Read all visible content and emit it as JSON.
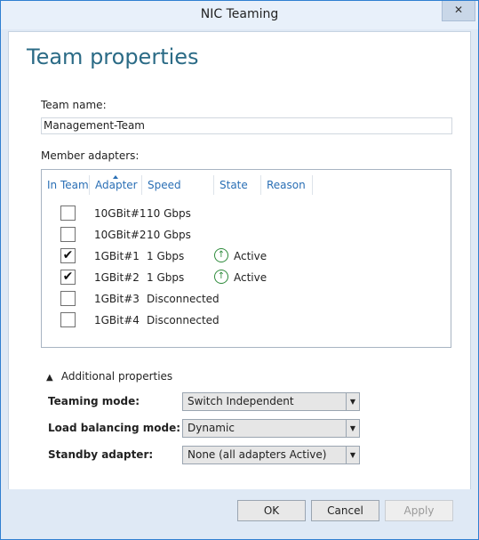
{
  "window": {
    "title": "NIC Teaming",
    "close_glyph": "✕"
  },
  "page_title": "Team properties",
  "team_name": {
    "label": "Team name:",
    "value": "Management-Team"
  },
  "member_adapters": {
    "label": "Member adapters:",
    "columns": [
      "In Team",
      "Adapter",
      "Speed",
      "State",
      "Reason"
    ],
    "rows": [
      {
        "in_team": false,
        "check": "",
        "adapter": "10GBit#1",
        "speed": "10 Gbps",
        "state": "",
        "reason": ""
      },
      {
        "in_team": false,
        "check": "",
        "adapter": "10GBit#2",
        "speed": "10 Gbps",
        "state": "",
        "reason": ""
      },
      {
        "in_team": true,
        "check": "✔",
        "adapter": "1GBit#1",
        "speed": "1 Gbps",
        "state": "Active",
        "reason": ""
      },
      {
        "in_team": true,
        "check": "✔",
        "adapter": "1GBit#2",
        "speed": "1 Gbps",
        "state": "Active",
        "reason": ""
      },
      {
        "in_team": false,
        "check": "",
        "adapter": "1GBit#3",
        "speed": "Disconnected",
        "state": "",
        "reason": ""
      },
      {
        "in_team": false,
        "check": "",
        "adapter": "1GBit#4",
        "speed": "Disconnected",
        "state": "",
        "reason": ""
      }
    ],
    "state_icon": "up-arrow-circle-icon"
  },
  "additional": {
    "toggle_label": "Additional properties",
    "teaming_mode": {
      "label": "Teaming mode:",
      "value": "Switch Independent"
    },
    "load_balancing": {
      "label": "Load balancing mode:",
      "value": "Dynamic"
    },
    "standby": {
      "label": "Standby adapter:",
      "value": "None (all adapters Active)"
    }
  },
  "buttons": {
    "ok": "OK",
    "cancel": "Cancel",
    "apply": "Apply"
  },
  "colors": {
    "accent_title": "#2b6b86",
    "header_link": "#2a6fb5",
    "active_green": "#2e8b3b"
  }
}
